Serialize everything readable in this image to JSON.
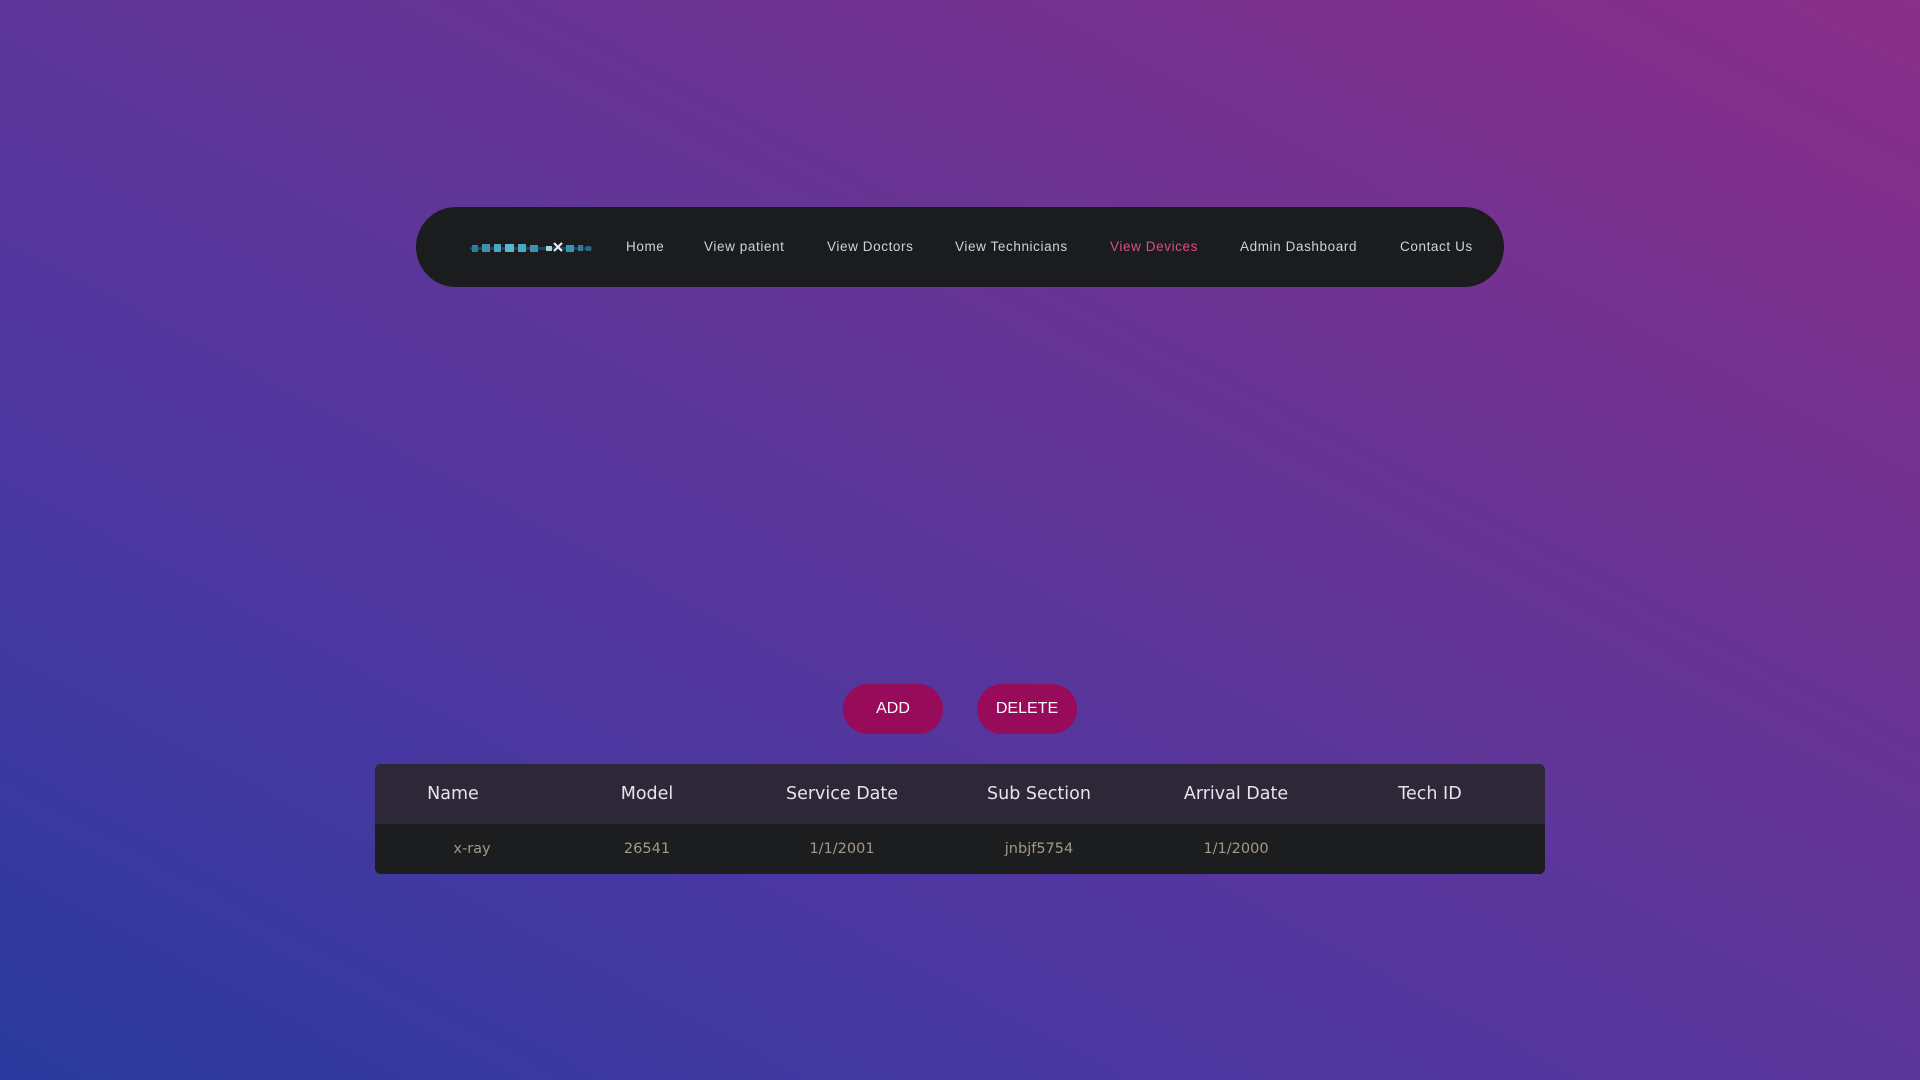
{
  "nav": {
    "logo_icon": "radiology-logo-icon",
    "links": [
      {
        "label": "Home"
      },
      {
        "label": "View patient"
      },
      {
        "label": "View Doctors"
      },
      {
        "label": "View Technicians"
      },
      {
        "label": "View Devices"
      },
      {
        "label": "Admin Dashboard"
      },
      {
        "label": "Contact Us"
      }
    ],
    "active_link": "View Devices",
    "active_color": "#e0498f"
  },
  "actions": {
    "add_label": "ADD",
    "delete_label": "DELETE",
    "button_color": "#980b5a"
  },
  "table": {
    "headers": [
      "Name",
      "Model",
      "Service Date",
      "Sub Section",
      "Arrival Date",
      "Tech ID"
    ],
    "rows": [
      [
        "x-ray",
        "26541",
        "1/1/2001",
        "jnbjf5754",
        "1/1/2000",
        ""
      ]
    ]
  },
  "colors": {
    "navbar_bg": "#1b1c1d",
    "table_header_bg": "#2c2838",
    "table_row_bg": "#1c1d1f"
  }
}
